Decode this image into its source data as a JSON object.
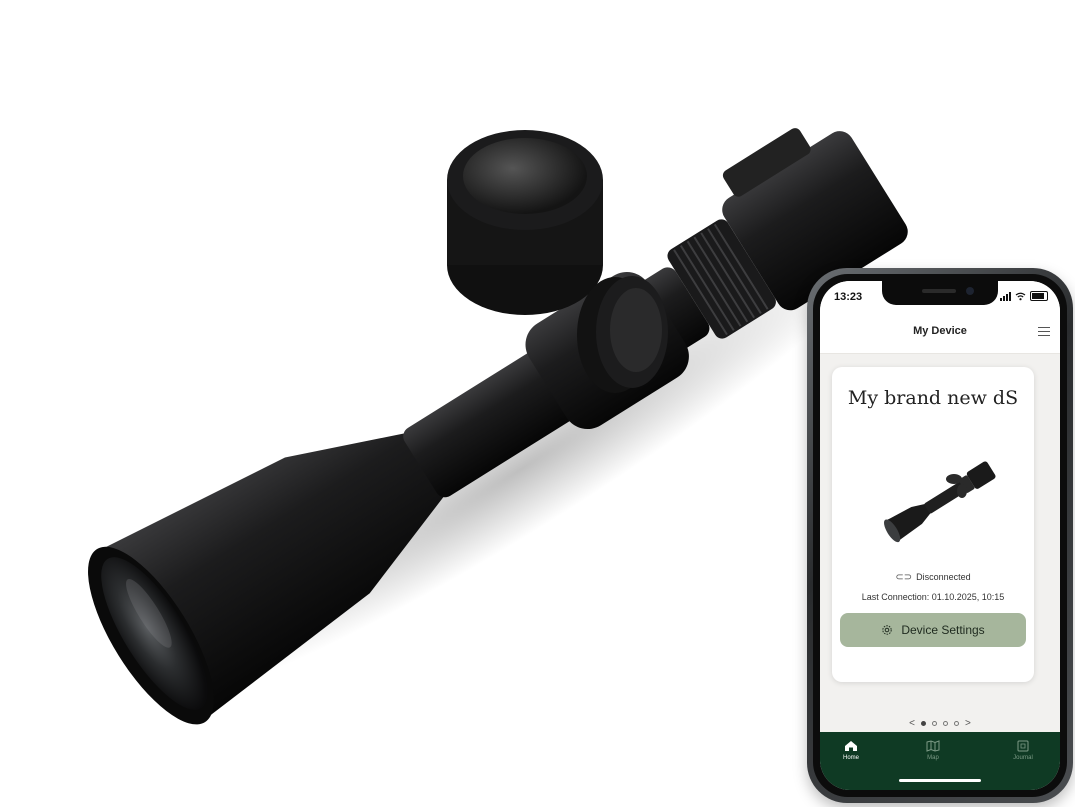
{
  "status_bar": {
    "time": "13:23"
  },
  "header": {
    "title": "My Device",
    "menu_icon": "hamburger-icon"
  },
  "device_card": {
    "name": "My brand new dS",
    "connection_status": "Disconnected",
    "connection_icon": "link-icon",
    "last_connection": "Last Connection: 01.10.2025, 10:15",
    "settings_button": "Device Settings",
    "settings_icon": "gear-icon"
  },
  "pager": {
    "prev": "<",
    "next": ">",
    "total": 4,
    "active": 1
  },
  "tab_bar": {
    "tabs": [
      {
        "label": "Home",
        "icon": "home-icon",
        "active": true
      },
      {
        "label": "Map",
        "icon": "map-icon",
        "active": false
      },
      {
        "label": "Journal",
        "icon": "journal-icon",
        "active": false
      }
    ]
  },
  "colors": {
    "tab_bar": "#0f3a24",
    "settings_button": "#a6b69c",
    "screen_bg": "#f2f1ef"
  }
}
